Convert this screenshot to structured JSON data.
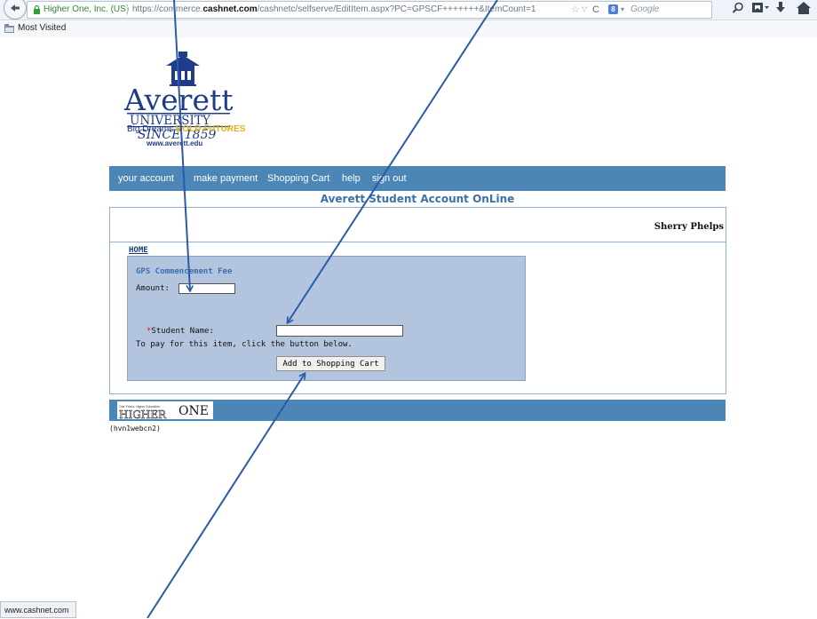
{
  "browser": {
    "site_identity": "Higher One, Inc. (US)",
    "url_prefix": "https://com",
    "url_obscured": "merce.",
    "url_domain": "cashnet.com",
    "url_path": "/cashnetc/selfserve/EditItem.aspx?PC=GPSCF+++++++&ItemCount=1",
    "search_placeholder": "Google",
    "bookmark_label": "Most Visited",
    "status_text": "www.cashnet.com"
  },
  "logo": {
    "wordmark": "Averett",
    "university": "UNIVERSITY",
    "since": "SINCE 1859",
    "tagline_blue": "Big Dreams",
    "tagline_gold": "BOLD FUTURES",
    "website": "www.averett.edu"
  },
  "nav": {
    "items": [
      "your account",
      "make payment",
      "Shopping Cart",
      "help",
      "sign out"
    ]
  },
  "page": {
    "title": "Averett Student Account OnLine",
    "user_name": "Sherry Phelps",
    "home_link": "HOME"
  },
  "form": {
    "item_title": "GPS Commencement Fee",
    "amount_label": "Amount:",
    "amount_value": "",
    "required_marker": "*",
    "student_label": "Student Name:",
    "student_value": "",
    "instructions": "To pay for this item, click the button below.",
    "submit_label": "Add to Shopping Cart"
  },
  "footer": {
    "logo_small": "One Focus: Higher Education",
    "logo_main": "HIGHER",
    "logo_one": "ONE",
    "server_id": "(hvn1webcn2)"
  },
  "colors": {
    "nav_bg": "#4b86b6",
    "panel_bg": "#b3c5de",
    "title_blue": "#3c71a6",
    "annotation_arrow": "#2b5aa8",
    "required": "#cc1111"
  }
}
